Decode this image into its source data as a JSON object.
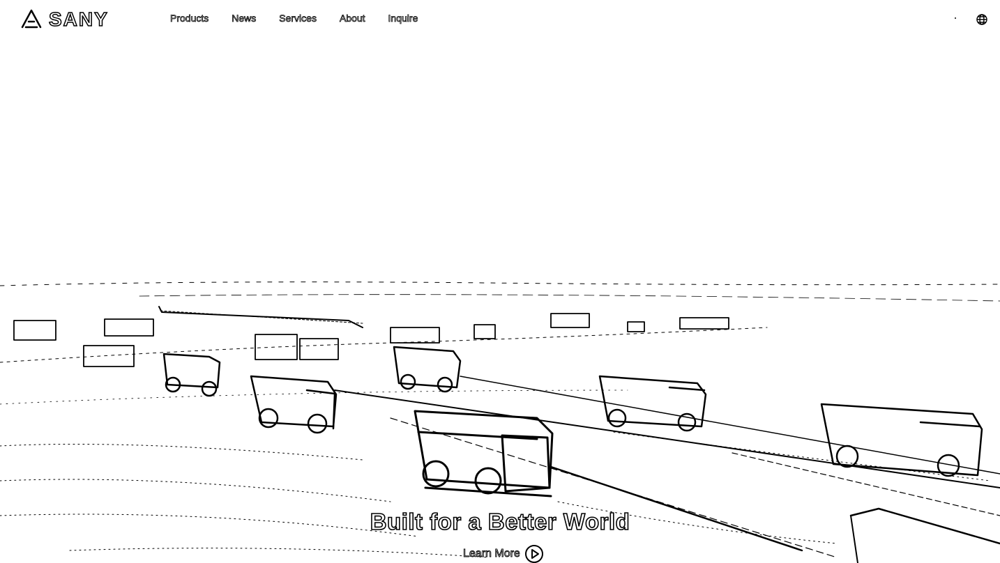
{
  "brand": {
    "name": "SANY",
    "logo_icon": "sany-mark-icon"
  },
  "nav": {
    "items": [
      {
        "label": "Products"
      },
      {
        "label": "News"
      },
      {
        "label": "Services"
      },
      {
        "label": "About"
      },
      {
        "label": "Inquire"
      }
    ]
  },
  "tools": {
    "search_icon": "search-icon",
    "language_icon": "globe-icon"
  },
  "hero": {
    "title": "Built for a Better World",
    "cta_label": "Learn More",
    "cta_icon": "play-circle-icon"
  }
}
